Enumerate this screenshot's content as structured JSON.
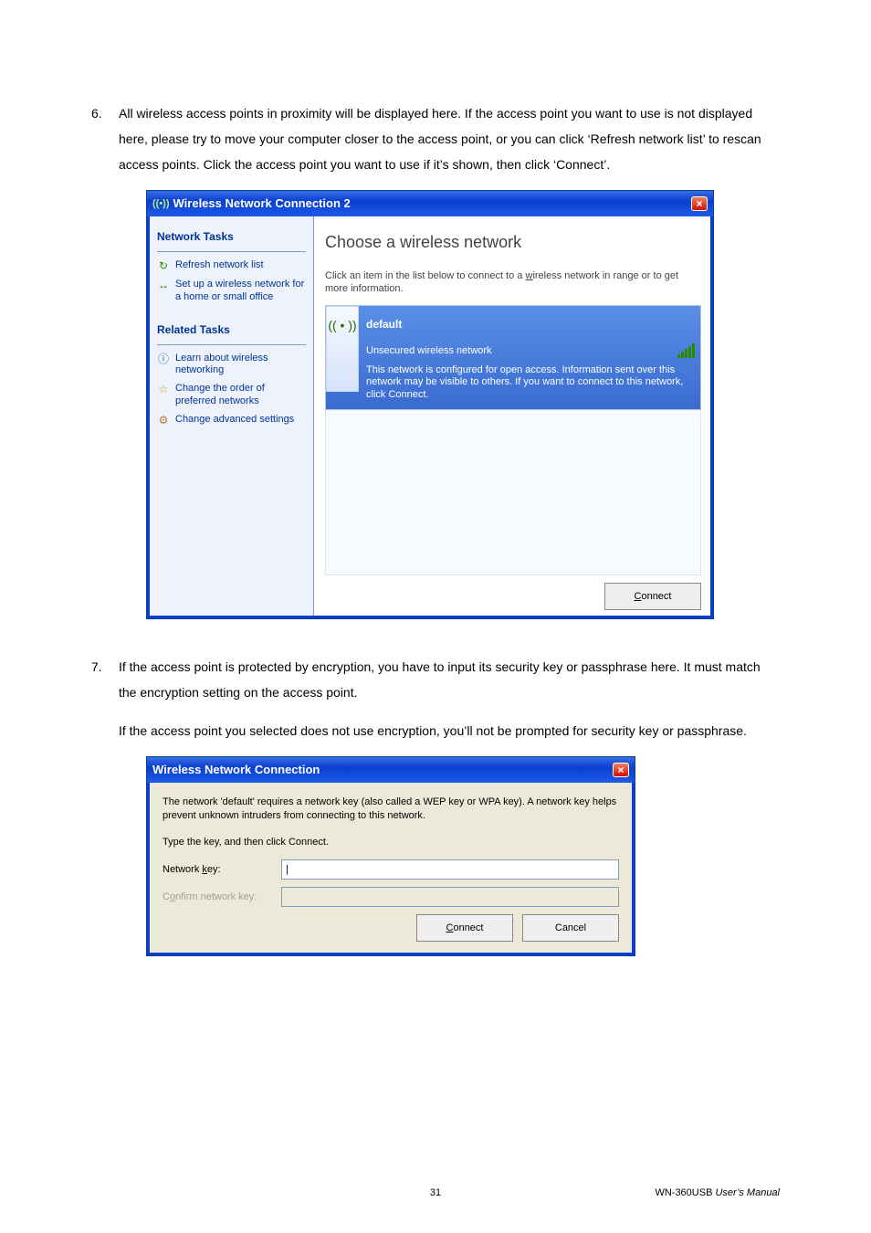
{
  "steps": {
    "s6": {
      "num": "6.",
      "text": "All wireless access points in proximity will be displayed here. If the access point you want to use is not displayed here, please try to move your computer closer to the access point, or you can click ‘Refresh network list’ to rescan access points. Click the access point you want to use if it’s shown, then click ‘Connect’."
    },
    "s7": {
      "num": "7.",
      "p1": "If the access point is protected by encryption, you have to input its security key or passphrase here. It must match the encryption setting on the access point.",
      "p2": "If the access point you selected does not use encryption, you’ll not be prompted for security key or passphrase."
    }
  },
  "dlg1": {
    "title": "Wireless Network Connection 2",
    "close": "×",
    "sidebar": {
      "groups": [
        {
          "title": "Network Tasks",
          "items": [
            {
              "icon": "refresh-icon",
              "glyph": "↻",
              "label": "Refresh network list"
            },
            {
              "icon": "setup-network-icon",
              "glyph": "↔",
              "label": "Set up a wireless network for a home or small office"
            }
          ]
        },
        {
          "title": "Related Tasks",
          "items": [
            {
              "icon": "info-icon",
              "glyph": "ⓘ",
              "label": "Learn about wireless networking"
            },
            {
              "icon": "star-icon",
              "glyph": "☆",
              "label": "Change the order of preferred networks"
            },
            {
              "icon": "gear-icon",
              "glyph": "⚙",
              "label": "Change advanced settings"
            }
          ]
        }
      ]
    },
    "main": {
      "title": "Choose a wireless network",
      "desc_1": "Click an item in the list below to connect to a ",
      "desc_w": "w",
      "desc_2": "ireless network in range or to get more information.",
      "net": {
        "name": "default",
        "security": "Unsecured wireless network",
        "warn": "This network is configured for open access. Information sent over this network may be visible to others. If you want to connect to this network, click Connect."
      },
      "connect": "Connect"
    }
  },
  "dlg2": {
    "title": "Wireless Network Connection",
    "close": "×",
    "msg1": "The network 'default' requires a network key (also called a WEP key or WPA key). A network key helps prevent unknown intruders from connecting to this network.",
    "msg2": "Type the key, and then click Connect.",
    "label_key": "Network key:",
    "label_confirm": "Confirm network key:",
    "btn_connect": "Connect",
    "btn_cancel": "Cancel"
  },
  "footer": {
    "page": "31",
    "doc_left": "WN-360USB  ",
    "doc_right": "User’s  Manual"
  }
}
